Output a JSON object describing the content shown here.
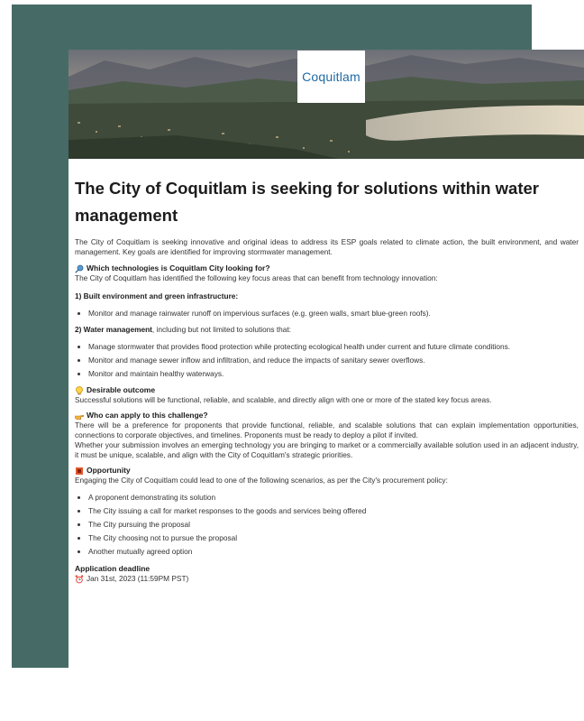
{
  "brand": {
    "logo_text": "Coquitlam",
    "accent": "#1f6aa5",
    "backdrop_color": "#466b66"
  },
  "doc": {
    "title": "The City of Coquitlam is seeking for solutions within water management",
    "intro": "The City of Coquitlam is seeking innovative and original ideas to address its ESP goals related to climate action, the built environment, and water management. Key goals are identified for improving stormwater management.",
    "technologies": {
      "heading": "Which technologies is Coquitlam City looking for?",
      "icon": "magnifier-icon",
      "text": "The City of Coquitlam has identified the following key focus areas that can benefit from technology innovation:"
    },
    "focus1": {
      "title": "1) Built environment and green infrastructure:",
      "items": [
        "Monitor and manage rainwater runoff on impervious surfaces (e.g. green walls, smart blue-green roofs)."
      ]
    },
    "focus2": {
      "title_bold": "2) Water management",
      "title_rest": ", including but not limited to solutions that:",
      "items": [
        "Manage stormwater that provides flood protection while protecting ecological health under current and future climate conditions.",
        "Monitor and manage sewer inflow and infiltration, and reduce the impacts of sanitary sewer overflows.",
        "Monitor and maintain healthy waterways."
      ]
    },
    "outcome": {
      "heading": "Desirable outcome",
      "icon": "lightbulb-icon",
      "text": "Successful solutions will be functional, reliable, and scalable, and directly align with one or more of the stated key focus areas."
    },
    "who": {
      "heading": "Who can apply to this challenge?",
      "icon": "pointing-hand-icon",
      "text1": "There will be a preference for proponents that provide functional, reliable, and scalable solutions that can explain implementation opportunities, connections to corporate objectives, and timelines. Proponents must be ready to deploy a pilot if invited.",
      "text2": "Whether your submission involves an emerging technology you are bringing to market or a commercially available solution used in an adjacent industry, it must be unique, scalable, and align with the City of Coquitlam's strategic priorities."
    },
    "opportunity": {
      "heading": "Opportunity",
      "icon": "flag-icon",
      "text": "Engaging the City of Coquitlam could lead to one of the following scenarios, as per the City's procurement policy:",
      "items": [
        "A proponent demonstrating its solution",
        "The City issuing a call for market responses to the goods and services being offered",
        "The City pursuing the proposal",
        "The City choosing not to pursue the proposal",
        "Another mutually agreed option"
      ]
    },
    "deadline": {
      "label": "Application deadline",
      "icon": "alarm-clock-icon",
      "value": "Jan 31st, 2023 (11:59PM PST)"
    }
  }
}
